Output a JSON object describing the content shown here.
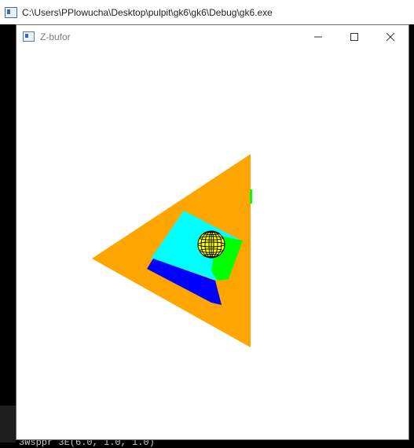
{
  "console": {
    "title": "C:\\Users\\PPlowucha\\Desktop\\pulpit\\gk6\\gk6\\Debug\\gk6.exe",
    "bottom_text": "3Wsppr 3E(6.0, 1.0, 1.0)"
  },
  "window": {
    "title": "Z-bufor",
    "controls": {
      "minimize": "minimize",
      "maximize": "maximize",
      "close": "close"
    }
  },
  "scene": {
    "colors": {
      "triangle": "#ffa500",
      "cyan": "#00ffff",
      "blue": "#0000ff",
      "green": "#00ff00",
      "sphere": "#ffff00",
      "wire": "#000000"
    }
  }
}
